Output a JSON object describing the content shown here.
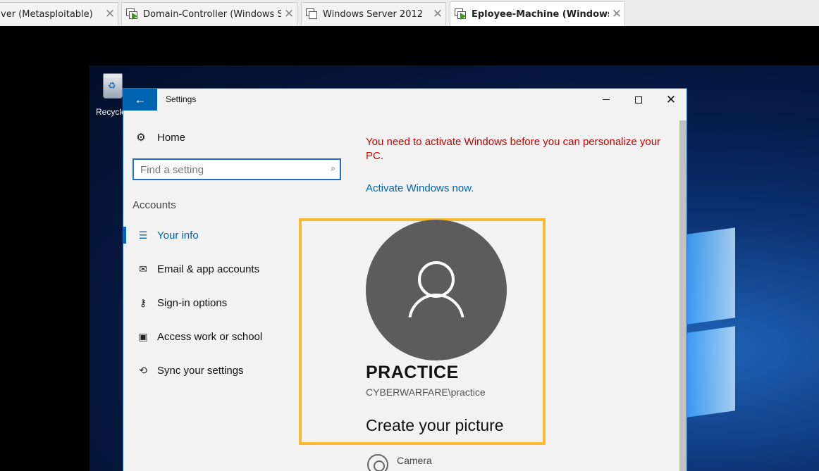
{
  "host_tabs": [
    {
      "label": "ver (Metasploitable)",
      "active": false
    },
    {
      "label": "Domain-Controller (Windows S...",
      "active": false
    },
    {
      "label": "Windows Server 2012",
      "active": false
    },
    {
      "label": "Eployee-Machine (Windows ...",
      "active": true
    }
  ],
  "desktop": {
    "recycle_label": "Recycle"
  },
  "window": {
    "title": "Settings",
    "back_icon": "arrow-left-icon",
    "minimize_icon": "minimize-icon",
    "maximize_icon": "maximize-icon",
    "close_icon": "close-icon"
  },
  "sidebar": {
    "home_label": "Home",
    "home_icon": "gear-icon",
    "search_placeholder": "Find a setting",
    "search_icon": "search-icon",
    "section_label": "Accounts",
    "items": [
      {
        "label": "Your info",
        "icon": "person-list-icon",
        "active": true
      },
      {
        "label": "Email & app accounts",
        "icon": "mail-icon",
        "active": false
      },
      {
        "label": "Sign-in options",
        "icon": "key-icon",
        "active": false
      },
      {
        "label": "Access work or school",
        "icon": "briefcase-icon",
        "active": false
      },
      {
        "label": "Sync your settings",
        "icon": "sync-icon",
        "active": false
      }
    ]
  },
  "content": {
    "warning": "You need to activate Windows before you can personalize your PC.",
    "activate_link": "Activate Windows now.",
    "user_name": "PRACTICE",
    "user_domain": "CYBERWARFARE\\practice",
    "create_picture": "Create your picture",
    "camera_label": "Camera"
  },
  "colors": {
    "accent": "#0063b1",
    "warning_text": "#c50500",
    "highlight_border": "#f9b931"
  }
}
